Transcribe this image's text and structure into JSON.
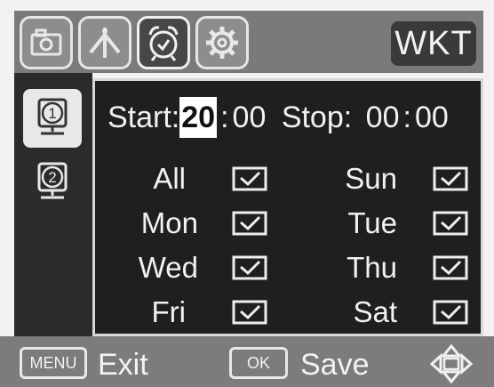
{
  "tabs": [
    {
      "icon": "camera-icon",
      "active": false
    },
    {
      "icon": "network-icon",
      "active": false
    },
    {
      "icon": "alarm-clock-icon",
      "active": true
    },
    {
      "icon": "gear-icon",
      "active": false
    }
  ],
  "header": {
    "badge": "WKT"
  },
  "sidebar": {
    "items": [
      {
        "icon": "timer-1-icon",
        "label": "1",
        "active": true
      },
      {
        "icon": "timer-2-icon",
        "label": "2",
        "active": false
      }
    ]
  },
  "schedule": {
    "start_label": "Start:",
    "start_hour": "20",
    "start_sep": ":",
    "start_minute": "00",
    "stop_label": "Stop:",
    "stop_hour": "00",
    "stop_sep": ":",
    "stop_minute": "00"
  },
  "days": [
    {
      "label": "All",
      "checked": true
    },
    {
      "label": "Sun",
      "checked": true
    },
    {
      "label": "Mon",
      "checked": true
    },
    {
      "label": "Tue",
      "checked": true
    },
    {
      "label": "Wed",
      "checked": true
    },
    {
      "label": "Thu",
      "checked": true
    },
    {
      "label": "Fri",
      "checked": true
    },
    {
      "label": "Sat",
      "checked": true
    }
  ],
  "footer": {
    "menu_key": "MENU",
    "exit_label": "Exit",
    "ok_key": "OK",
    "save_label": "Save",
    "nav_icon": "dpad-icon"
  },
  "colors": {
    "panel_bg": "#1f1f1f",
    "tab_active": "#474747",
    "bar_gray": "#7a7a7a"
  }
}
